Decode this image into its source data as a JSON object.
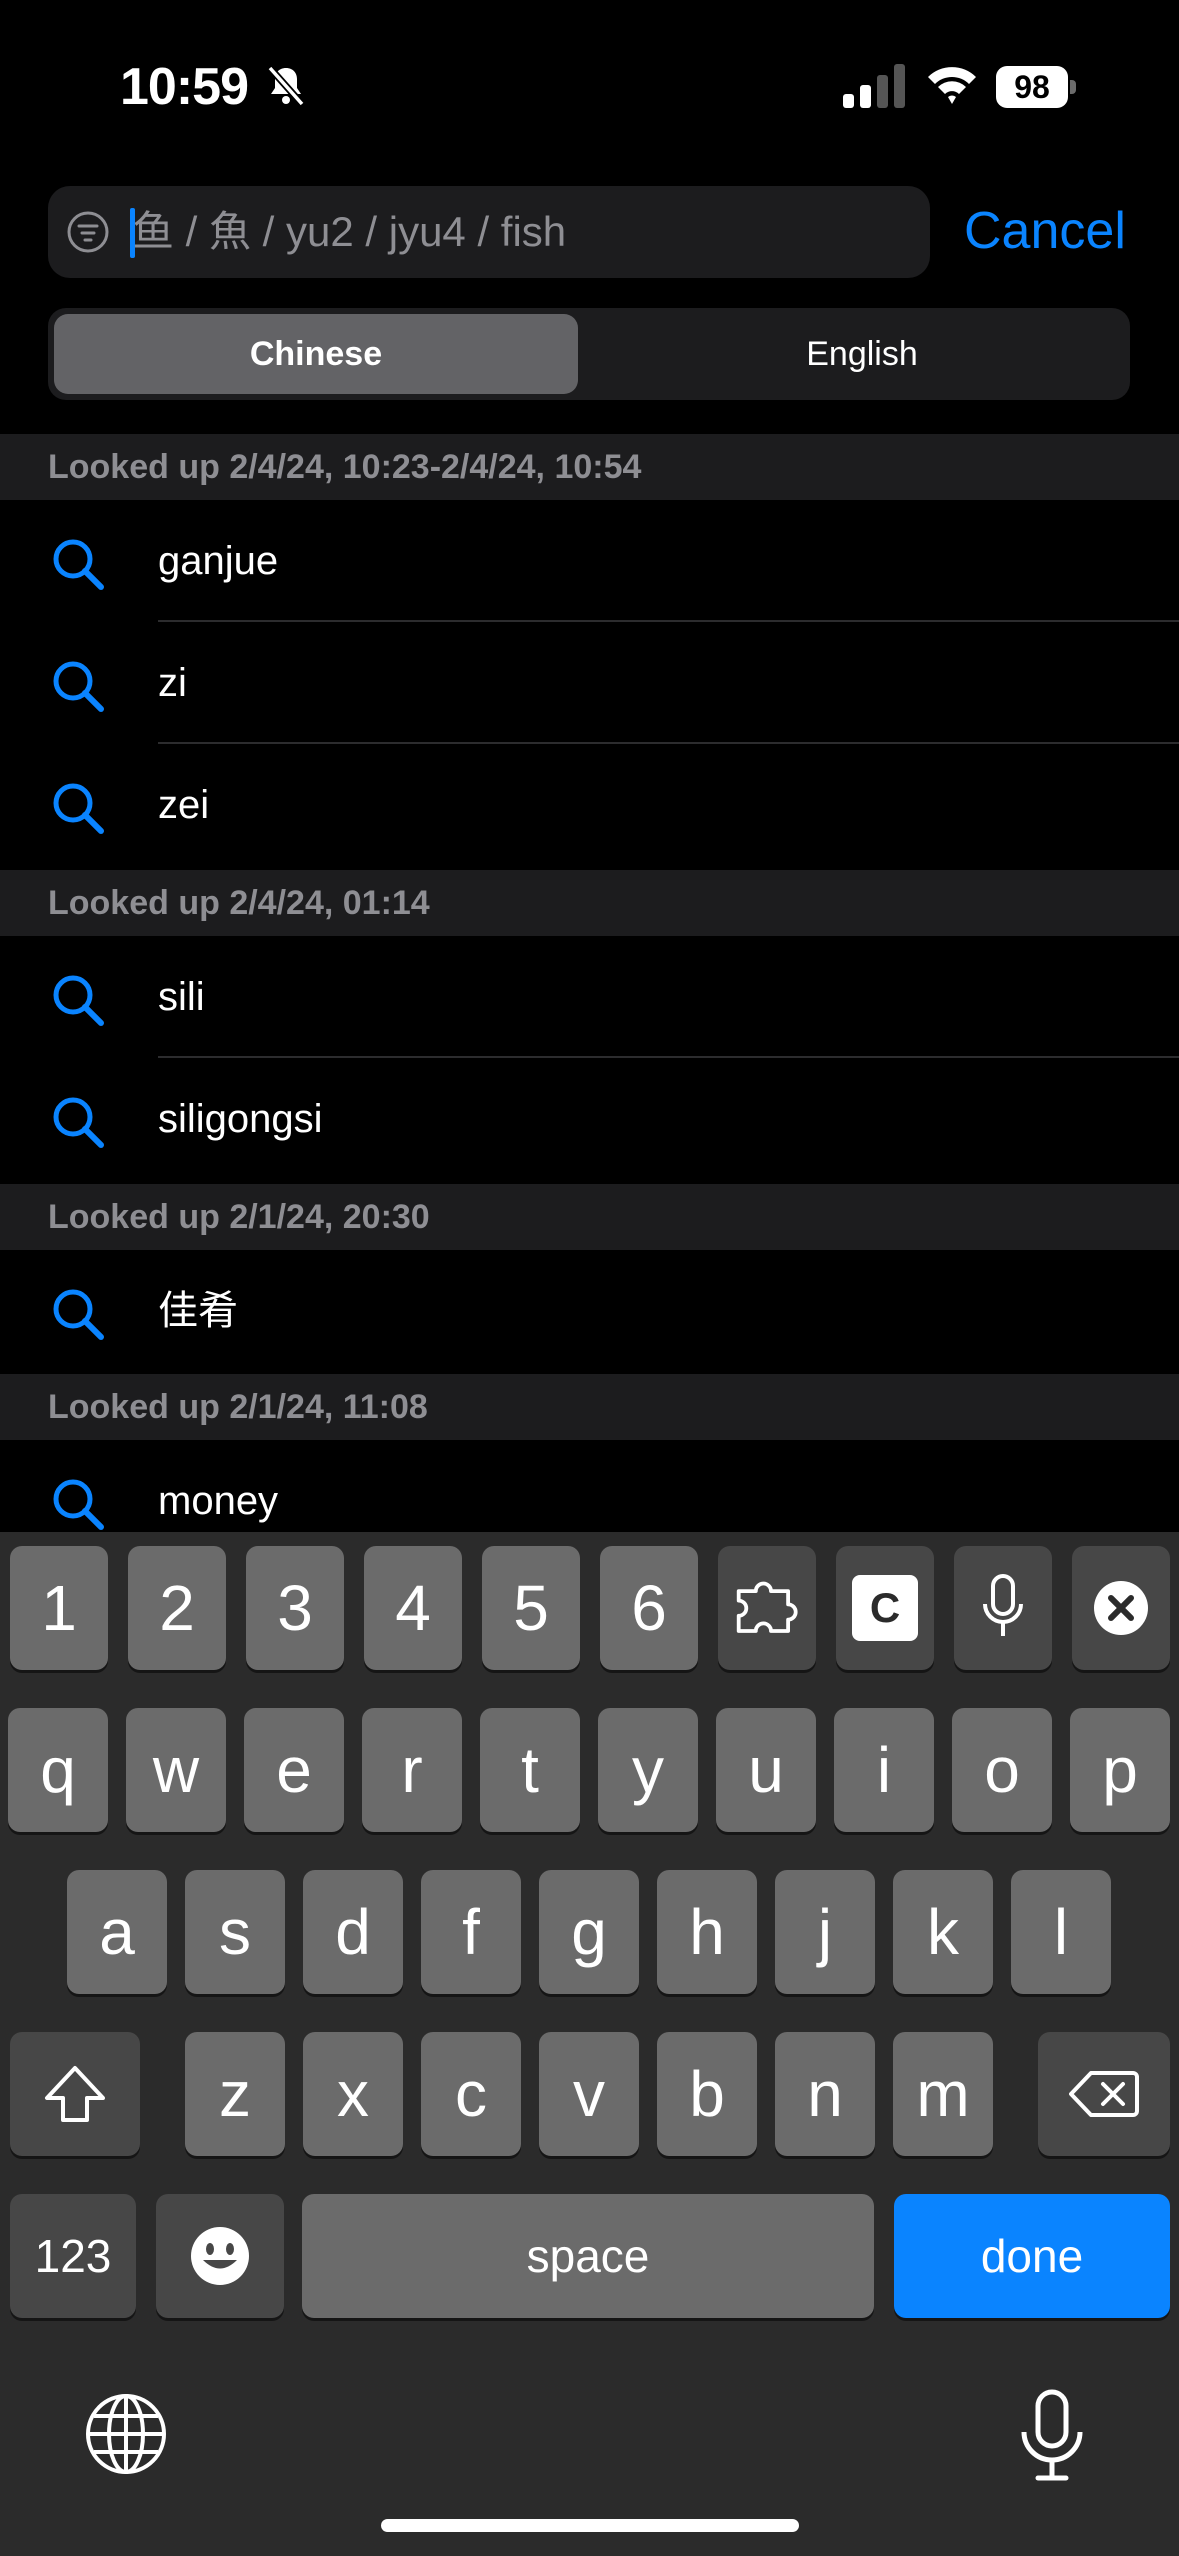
{
  "status_bar": {
    "time": "10:59",
    "battery": "98"
  },
  "search": {
    "placeholder": "鱼 / 魚 / yu2 / jyu4 / fish",
    "cancel_label": "Cancel"
  },
  "segmented": {
    "options": [
      "Chinese",
      "English"
    ],
    "selected": "Chinese"
  },
  "history": [
    {
      "header": "Looked up 2/4/24, 10:23-2/4/24, 10:54",
      "items": [
        "ganjue",
        "zi",
        "zei"
      ]
    },
    {
      "header": "Looked up 2/4/24, 01:14",
      "items": [
        "sili",
        "siligongsi"
      ]
    },
    {
      "header": "Looked up 2/1/24, 20:30",
      "items": [
        "佳肴"
      ]
    },
    {
      "header": "Looked up 2/1/24, 11:08",
      "items": [
        "money"
      ]
    }
  ],
  "keyboard": {
    "number_row": [
      "1",
      "2",
      "3",
      "4",
      "5",
      "6"
    ],
    "row1": [
      "q",
      "w",
      "e",
      "r",
      "t",
      "y",
      "u",
      "i",
      "o",
      "p"
    ],
    "row2": [
      "a",
      "s",
      "d",
      "f",
      "g",
      "h",
      "j",
      "k",
      "l"
    ],
    "row3": [
      "z",
      "x",
      "c",
      "v",
      "b",
      "n",
      "m"
    ],
    "numbers_label": "123",
    "space_label": "space",
    "done_label": "done",
    "clip_label": "C"
  },
  "colors": {
    "accent": "#0a84ff",
    "background": "#000000",
    "section_header": "#1c1c1e"
  }
}
